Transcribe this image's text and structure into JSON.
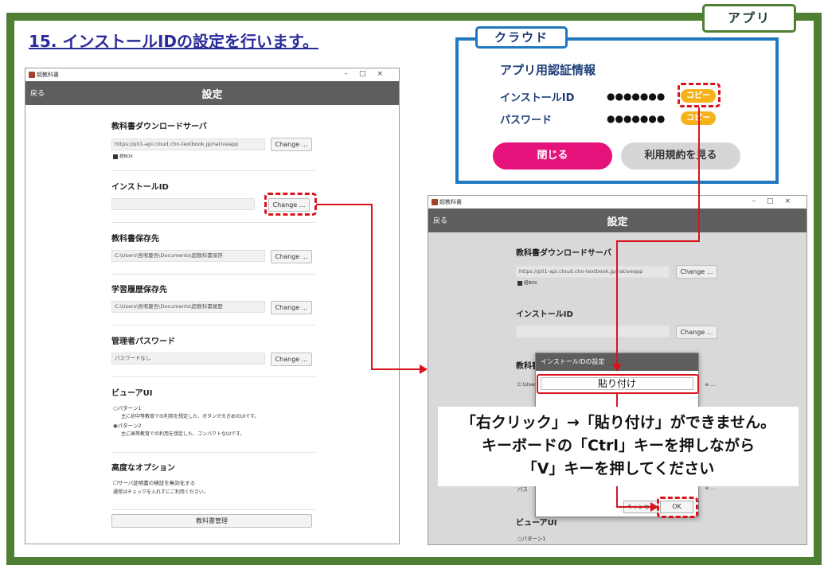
{
  "app_tag": "アプリ",
  "step_title": "15. インストールIDの設定を行います。",
  "left_window": {
    "window_title": "超教科書",
    "back": "戻る",
    "header_title": "設定",
    "server_label": "教科書ダウンロードサーバ",
    "server_value": "https://p01-api.cloud.cho-textbook.jp/nativeapp",
    "change_label": "Change ...",
    "logo_text": "超BOX",
    "install_id_label": "インストールID",
    "install_id_value": "",
    "textbook_path_label": "教科書保存先",
    "textbook_path_value": "C:\\Users\\島塚慶吾\\Documents\\超教科書保存",
    "history_path_label": "学習履歴保存先",
    "history_path_value": "C:\\Users\\島塚慶吾\\Documents\\超教科書履歴",
    "admin_pw_label": "管理者パスワード",
    "admin_pw_value": "パスワードなし",
    "viewer_label": "ビューアUI",
    "pattern1": "○パターン1",
    "pattern1_desc": "主に初中等教育での利用を想定した、ボタンが大きめのUIです。",
    "pattern2": "◉パターン2",
    "pattern2_desc": "主に高等教育での利用を想定した、コンパクトなUIです。",
    "advanced_label": "高度なオプション",
    "cert_option": "☐サーバ証明書の検証を無効化する",
    "cert_desc": "通常はチェックを入れずにご利用ください。",
    "textbook_manage": "教科書管理"
  },
  "right_window": {
    "window_title": "超教科書",
    "back": "戻る",
    "header_title": "設定",
    "server_label": "教科書ダウンロードサーバ",
    "server_value": "https://p01-api.cloud.cho-textbook.jp/nativeapp",
    "change_label": "Change ...",
    "logo_text": "超BOX",
    "install_id_label": "インストールID",
    "textbook_label_partial": "教科書",
    "path_partial": "C:\\Users",
    "change_partial": "e ...",
    "path_partial2": "パス",
    "viewer_label": "ビューアUI",
    "pattern1": "○パターン1"
  },
  "dialog": {
    "title": "インストールIDの設定",
    "paste_item": "貼り付け",
    "cancel": "キャンセル",
    "ok": "OK"
  },
  "cloud": {
    "tag": "クラウド",
    "heading": "アプリ用認証情報",
    "install_id_label": "インストールID",
    "install_id_value": "●●●●●●●",
    "password_label": "パスワード",
    "password_value": "●●●●●●●",
    "copy_label": "コピー",
    "close_button": "閉じる",
    "terms_button": "利用規約を見る"
  },
  "callout": {
    "line1": "「右クリック」→「貼り付け」ができません。",
    "line2": "キーボードの「Ctrl」キーを押しながら",
    "line3": "「V」キーを押してください"
  },
  "colors": {
    "frame_green": "#4f7f32",
    "cloud_blue": "#1f78c0",
    "marker_red": "#d8141c",
    "close_pink": "#e5127b",
    "copy_yellow": "#f5b21b"
  }
}
